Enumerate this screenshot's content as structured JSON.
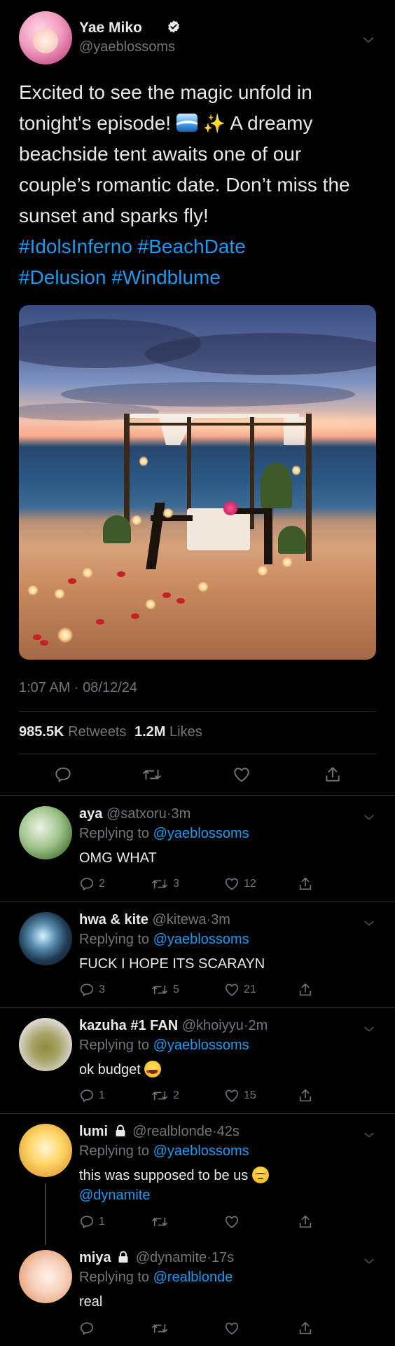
{
  "tweet": {
    "author_name": "Yae Miko",
    "author_handle": "@yaeblossoms",
    "text_line1": "Excited to see the magic unfold in",
    "text_line2a": "tonight's episode!",
    "text_line2b": "A dreamy",
    "text_rest": "beachside tent awaits one of our couple’s romantic date. Don’t miss the sunset and sparks fly!",
    "hashtags": [
      "#IdolsInferno",
      "#BeachDate",
      "#Delusion",
      "#Windblume"
    ],
    "timestamp": "1:07 AM · 08/12/24",
    "retweets_count": "985.5K",
    "retweets_label": "Retweets",
    "likes_count": "1.2M",
    "likes_label": "Likes"
  },
  "replies": [
    {
      "name": "aya",
      "handle": "@satxoru",
      "time": "3m",
      "replying_label": "Replying to",
      "replying_to": "@yaeblossoms",
      "text": "OMG WHAT",
      "replies": "2",
      "retweets": "3",
      "likes": "12"
    },
    {
      "name": "hwa & kite",
      "handle": "@kitewa",
      "time": "3m",
      "replying_label": "Replying to",
      "replying_to": "@yaeblossoms",
      "text": "FUCK I HOPE ITS SCARAYN",
      "replies": "3",
      "retweets": "5",
      "likes": "21"
    },
    {
      "name": "kazuha #1 FAN",
      "handle": "@khoiyyu",
      "time": "2m",
      "replying_label": "Replying to",
      "replying_to": "@yaeblossoms",
      "text": "ok budget",
      "replies": "1",
      "retweets": "2",
      "likes": "15"
    },
    {
      "name": "lumi",
      "handle": "@realblonde",
      "time": "42s",
      "replying_label": "Replying to",
      "replying_to": "@yaeblossoms",
      "text": "this was supposed to be us",
      "mention": "@dynamite",
      "replies": "1",
      "retweets": "",
      "likes": ""
    },
    {
      "name": "miya",
      "handle": "@dynamite",
      "time": "17s",
      "replying_label": "Replying to",
      "replying_to": "@realblonde",
      "text": "real",
      "replies": "",
      "retweets": "",
      "likes": ""
    }
  ],
  "icons": {
    "verified": "verified-badge-icon",
    "chevron": "chevron-down-icon",
    "reply": "reply-icon",
    "retweet": "retweet-icon",
    "like": "heart-icon",
    "share": "share-icon",
    "lock": "lock-icon"
  },
  "colors": {
    "background": "#000000",
    "text": "#e7e9ea",
    "secondary": "#71767b",
    "link": "#1d9bf0",
    "divider": "#2f3336"
  },
  "separator": "·"
}
